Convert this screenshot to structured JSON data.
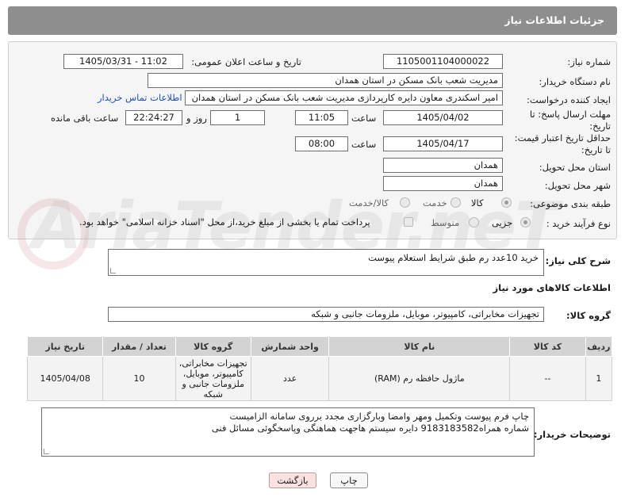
{
  "header": {
    "title": "جزئیات اطلاعات نیاز"
  },
  "form": {
    "need_number_label": "شماره نیاز:",
    "need_number": "1105001104000022",
    "announce_label": "تاریخ و ساعت اعلان عمومی:",
    "announce_value": "1405/03/31 - 11:02",
    "buyer_org_label": "نام دستگاه خریدار:",
    "buyer_org": "مدیریت شعب بانک مسکن در استان همدان",
    "creator_label": "ایجاد کننده درخواست:",
    "creator": "امیر اسکندری معاون دایره کارپردازی مدیریت شعب بانک مسکن در استان همدان",
    "contact_link": "اطلاعات تماس خریدار",
    "reply_deadline_label_1": "مهلت ارسال پاسخ: تا",
    "reply_deadline_label_2": "تاریخ:",
    "reply_date": "1405/04/02",
    "time_label": "ساعت",
    "reply_time": "11:05",
    "days_value": "1",
    "days_label": "روز و",
    "remaining_time": "22:24:27",
    "remaining_label": "ساعت باقی مانده",
    "validity_label_1": "حداقل تاریخ اعتبار قیمت:",
    "validity_label_2": "تا تاریخ:",
    "validity_date": "1405/04/17",
    "validity_time": "08:00",
    "province_label": "استان محل تحویل:",
    "province": "همدان",
    "city_label": "شهر محل تحویل:",
    "city": "همدان",
    "category_label": "طبقه بندی موضوعی:",
    "category_options": [
      "کالا",
      "خدمت",
      "کالا/خدمت"
    ],
    "process_label": "نوع فرآیند خرید :",
    "process_options": [
      "جزیی",
      "متوسط"
    ],
    "payment_note": "پرداخت تمام یا بخشی از مبلغ خرید،از محل \"اسناد خزانه اسلامی\" خواهد بود."
  },
  "description": {
    "label": "شرح کلی نیاز:",
    "text": "خرید 10عدد رم طبق شرایط استعلام پیوست"
  },
  "goods_section": {
    "title": "اطلاعات کالاهای مورد نیاز",
    "group_label": "گروه کالا:",
    "group_value": "تجهیزات مخابراتی، کامپیوتر، موبایل، ملزومات جانبی و شبکه"
  },
  "table": {
    "headers": [
      "ردیف",
      "کد کالا",
      "نام کالا",
      "واحد شمارش",
      "گروه کالا",
      "تعداد / مقدار",
      "تاریخ نیاز"
    ],
    "rows": [
      [
        "1",
        "--",
        "ماژول حافظه رم (RAM)",
        "عدد",
        "تجهیزات مخابراتی، کامپیوتر، موبایل، ملزومات جانبی و شبکه",
        "10",
        "1405/04/08"
      ]
    ]
  },
  "buyer_notes": {
    "label": "توضیحات خریدار:",
    "line1": "چاپ فرم پیوست وتکمیل ومهر وامضا وبارگزاری مجدد برروی سامانه الزامیست",
    "line2": "شماره همراه9183183582  دایره سیستم هاجهت هماهنگی وپاسخگوئی مسائل فنی"
  },
  "buttons": {
    "print": "چاپ",
    "back": "بازگشت"
  },
  "watermark": "AriaTender.neT"
}
